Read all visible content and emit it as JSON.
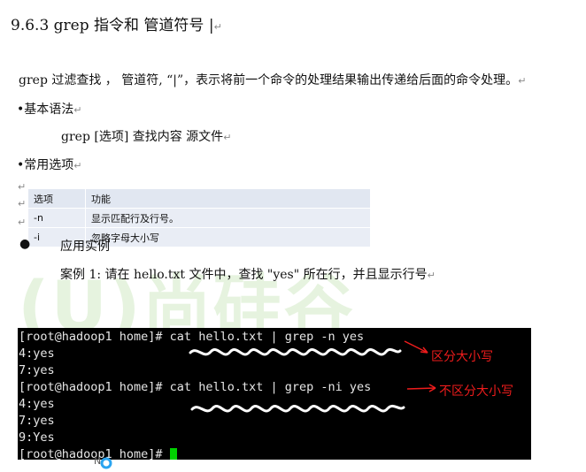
{
  "heading": "9.6.3  grep 指令和 管道符号 |",
  "intro": "grep  过滤查找 ，  管道符, “|”，表示将前一个命令的处理结果输出传递给后面的命令处理。",
  "basic_syntax": {
    "title": "•基本语法",
    "usage": "grep [选项] 查找内容 源文件"
  },
  "common_options": {
    "title": "•常用选项",
    "table_header": [
      "选项",
      "功能"
    ],
    "rows": [
      {
        "option": "-n",
        "desc": "显示匹配行及行号。"
      },
      {
        "option": "-i",
        "desc": "忽略字母大小写"
      }
    ]
  },
  "examples": {
    "title": "应用实例",
    "case1": "案例 1: 请在  hello.txt 文件中，查找   \"yes\"   所在行，并且显示行号"
  },
  "terminal": {
    "lines": [
      "[root@hadoop1 home]# cat hello.txt | grep -n yes",
      "4:yes",
      "7:yes",
      "[root@hadoop1 home]# cat hello.txt | grep -ni yes",
      "4:yes",
      "7:yes",
      "9:Yes",
      "[root@hadoop1 home]# "
    ],
    "annotation_1": "区分大小写",
    "annotation_2": "不区分大小写",
    "annotation_color": "#ee1c1c",
    "cursor_color": "#00d000"
  },
  "watermark": "(U)尚硅谷"
}
